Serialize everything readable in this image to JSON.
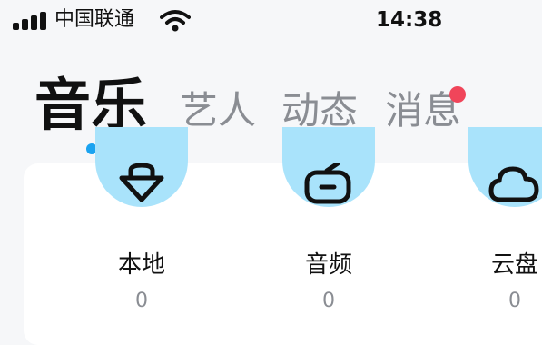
{
  "status_bar": {
    "carrier": "中国联通",
    "time": "14:38"
  },
  "tabs": [
    {
      "label": "音乐",
      "active": true
    },
    {
      "label": "艺人",
      "active": false
    },
    {
      "label": "动态",
      "active": false
    },
    {
      "label": "消息",
      "active": false,
      "has_badge_dot": true
    }
  ],
  "shortcuts": [
    {
      "label": "本地",
      "count": "0",
      "icon": "local-music-icon"
    },
    {
      "label": "音频",
      "count": "0",
      "icon": "radio-icon"
    },
    {
      "label": "云盘",
      "count": "0",
      "icon": "cloud-icon"
    }
  ],
  "colors": {
    "accent_dot": "#1aa3f0",
    "badge": "#f0455a",
    "icon_bg": "#a9e3fb",
    "inactive_text": "#8a8d93"
  }
}
